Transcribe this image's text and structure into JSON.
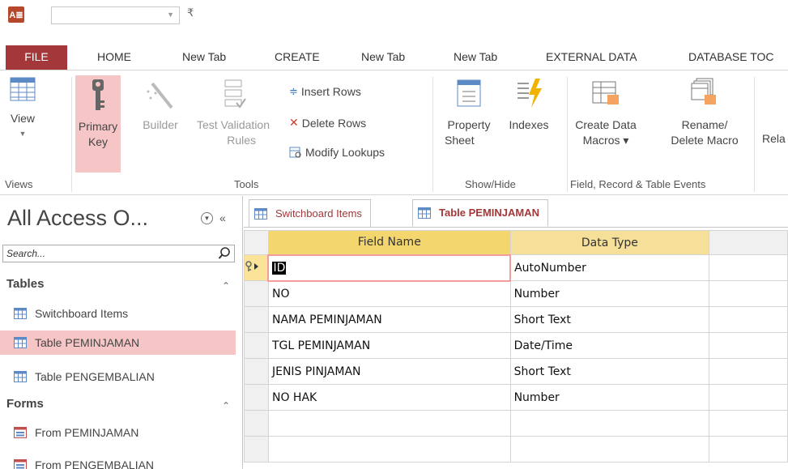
{
  "app": {
    "logo_text": "A≣",
    "qat_combo_value": "",
    "qat_more": "₹"
  },
  "tabs": [
    {
      "label": "FILE"
    },
    {
      "label": "HOME"
    },
    {
      "label": "New Tab"
    },
    {
      "label": "CREATE"
    },
    {
      "label": "New Tab"
    },
    {
      "label": "New Tab"
    },
    {
      "label": "EXTERNAL DATA"
    },
    {
      "label": "DATABASE TOC"
    }
  ],
  "ribbon": {
    "views": {
      "view_label": "View",
      "group_label": "Views"
    },
    "tools": {
      "primary_key_line1": "Primary",
      "primary_key_line2": "Key",
      "builder_label": "Builder",
      "test_validation_line1": "Test Validation",
      "test_validation_line2": "Rules",
      "insert_rows": "Insert Rows",
      "delete_rows": "Delete Rows",
      "modify_lookups": "Modify Lookups",
      "group_label": "Tools"
    },
    "showhide": {
      "property_line1": "Property",
      "property_line2": "Sheet",
      "indexes": "Indexes",
      "group_label": "Show/Hide"
    },
    "events": {
      "create_data_line1": "Create Data",
      "create_data_line2": "Macros ▾",
      "rename_line1": "Rename/",
      "rename_line2": "Delete Macro",
      "group_label": "Field, Record & Table Events"
    },
    "relationships_partial": "Rela"
  },
  "nav": {
    "title": "All Access O...",
    "search_placeholder": "Search...",
    "sections": [
      {
        "label": "Tables",
        "items": [
          "Switchboard Items",
          "Table PEMINJAMAN",
          "Table PENGEMBALIAN"
        ]
      },
      {
        "label": "Forms",
        "items": [
          "From PEMINJAMAN",
          "From PENGEMBALIAN"
        ]
      }
    ]
  },
  "doc": {
    "tabs": [
      "Switchboard Items",
      "Table PEMINJAMAN"
    ],
    "active_tab": 1,
    "columns": [
      "Field Name",
      "Data Type"
    ],
    "rows": [
      {
        "field": "ID",
        "type": "AutoNumber"
      },
      {
        "field": "NO",
        "type": "Number"
      },
      {
        "field": "NAMA PEMINJAMAN",
        "type": "Short Text"
      },
      {
        "field": "TGL PEMINJAMAN",
        "type": "Date/Time"
      },
      {
        "field": "JENIS PINJAMAN",
        "type": "Short Text"
      },
      {
        "field": "NO HAK",
        "type": "Number"
      }
    ]
  },
  "colors": {
    "file_tab": "#a4373a",
    "selected": "#f6c6c7",
    "header": "#f5df99"
  }
}
